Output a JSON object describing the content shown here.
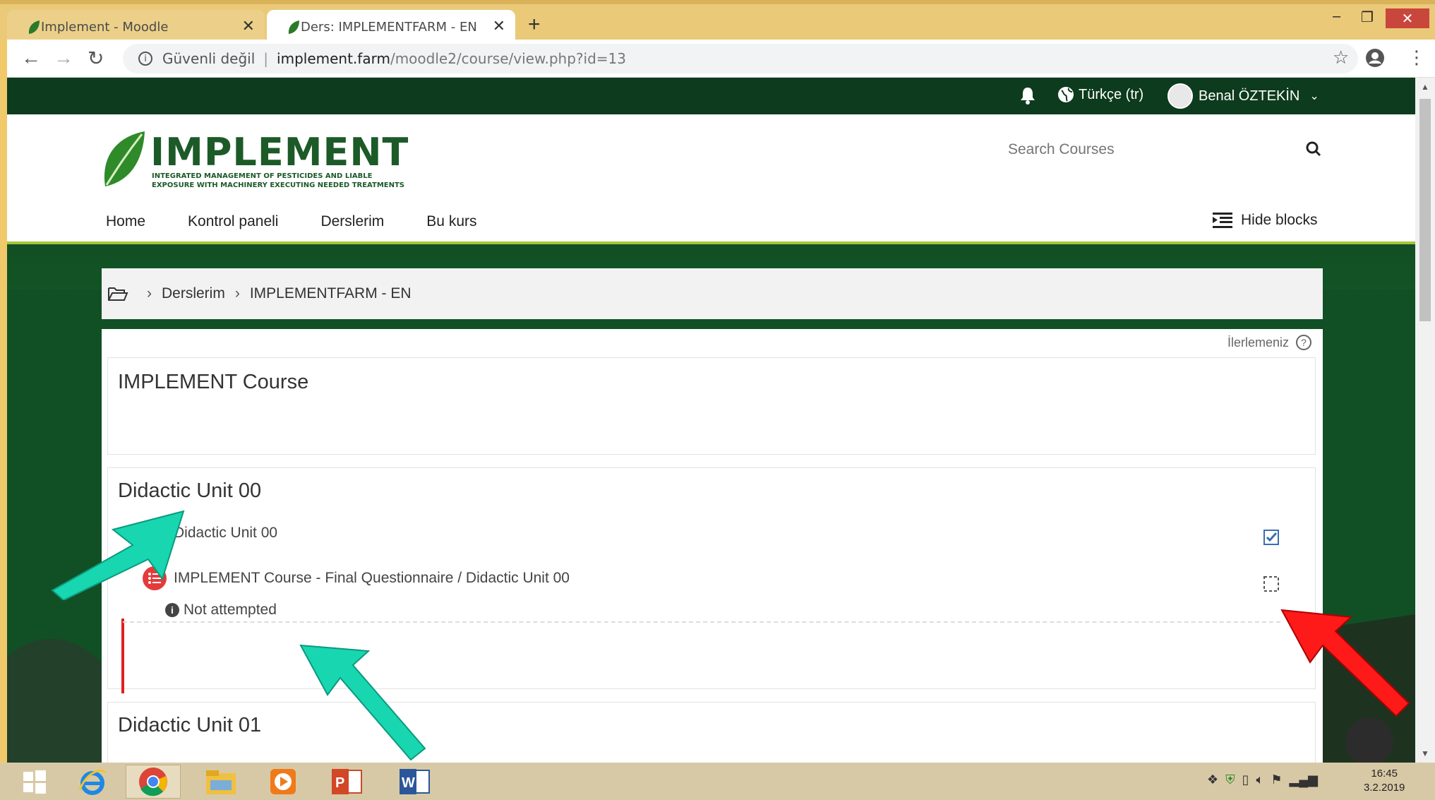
{
  "browser": {
    "tabs": [
      {
        "title": "Implement - Moodle"
      },
      {
        "title": "Ders: IMPLEMENTFARM - EN"
      }
    ],
    "address": {
      "security": "Güvenli değil",
      "host": "implement.farm",
      "path": "/moodle2/course/view.php?id=13"
    }
  },
  "topbar": {
    "language": "Türkçe (tr)",
    "user": "Benal ÖZTEKİN"
  },
  "header": {
    "logo_word": "IMPLEMENT",
    "logo_tag1": "INTEGRATED MANAGEMENT OF PESTICIDES AND LIABLE",
    "logo_tag2": "EXPOSURE WITH MACHINERY EXECUTING NEEDED TREATMENTS",
    "search_placeholder": "Search Courses",
    "nav": [
      "Home",
      "Kontrol paneli",
      "Derslerim",
      "Bu kurs"
    ],
    "hide_blocks": "Hide blocks"
  },
  "breadcrumb": [
    "Derslerim",
    "IMPLEMENTFARM - EN"
  ],
  "course": {
    "progress_label": "İlerlemeniz",
    "sections": [
      {
        "title": "IMPLEMENT Course"
      },
      {
        "title": "Didactic Unit 00",
        "activities": [
          {
            "label": "Didactic Unit 00",
            "completed": true
          },
          {
            "label": "IMPLEMENT Course - Final Questionnaire / Didactic Unit 00",
            "completed": false,
            "status": "Not attempted"
          }
        ]
      },
      {
        "title": "Didactic Unit 01"
      }
    ]
  },
  "taskbar": {
    "time": "16:45",
    "date": "3.2.2019"
  },
  "colors": {
    "topbar": "#0d3b1d",
    "accent_line": "#a8c43a",
    "logo_green": "#1c5a28",
    "annotation_teal": "#18d6b0",
    "annotation_red": "#ff1a1a"
  }
}
